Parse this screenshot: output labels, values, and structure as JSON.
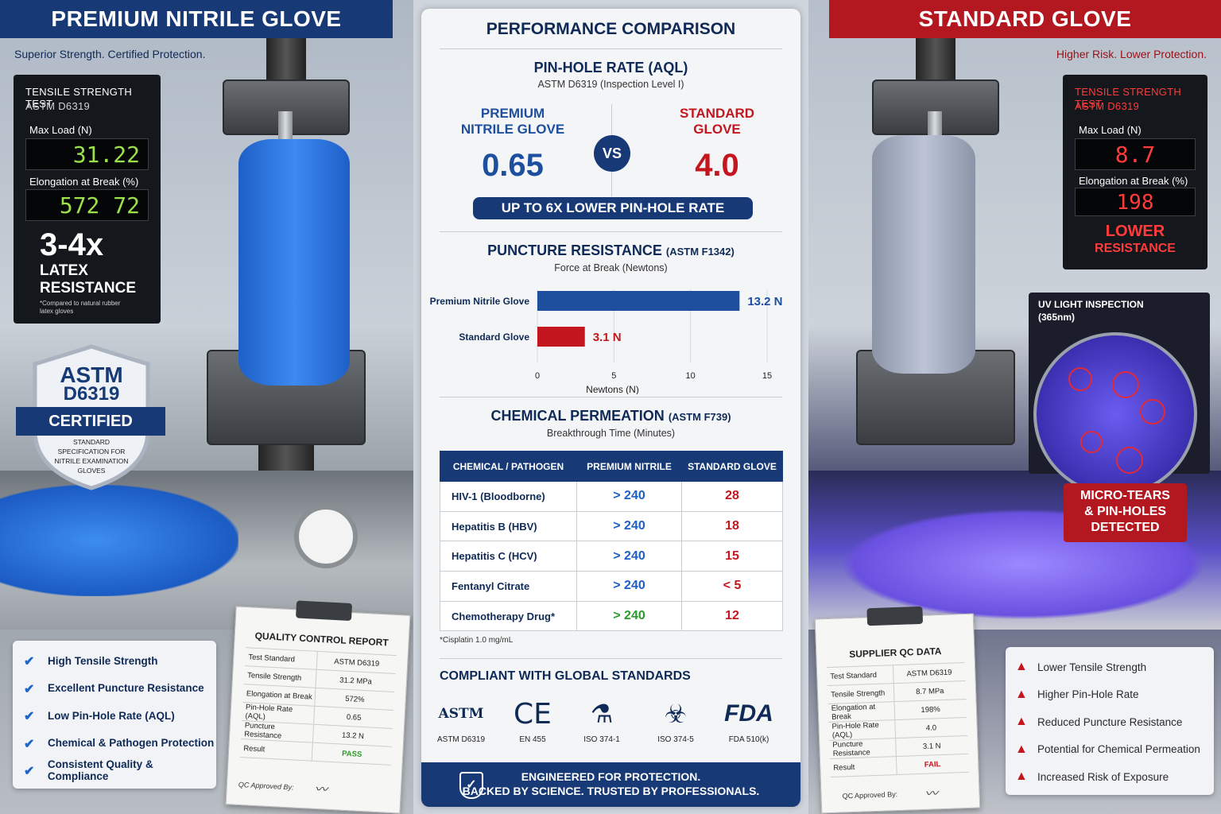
{
  "left": {
    "banner": "PREMIUM NITRILE GLOVE",
    "tagline": "Superior Strength. Certified Protection.",
    "test_panel": {
      "title": "TENSILE STRENGTH TEST",
      "standard": "ASTM D6319",
      "max_load_label": "Max Load (N)",
      "max_load_value": "31.22",
      "elongation_label": "Elongation at Break (%)",
      "elongation_value": "572 72",
      "headline": "3-4x",
      "sub1": "LATEX",
      "sub2": "RESISTANCE",
      "footnote": "*Compared to natural rubber latex gloves"
    },
    "badge": {
      "line1": "ASTM",
      "line2": "D6319",
      "ribbon": "CERTIFIED",
      "desc": "STANDARD SPECIFICATION FOR NITRILE EXAMINATION GLOVES"
    },
    "checklist": [
      "High Tensile Strength",
      "Excellent Puncture Resistance",
      "Low Pin-Hole Rate (AQL)",
      "Chemical & Pathogen Protection",
      "Consistent Quality & Compliance"
    ],
    "report": {
      "title": "QUALITY CONTROL REPORT",
      "rows": [
        {
          "k": "Test Standard",
          "v": "ASTM D6319"
        },
        {
          "k": "Tensile Strength",
          "v": "31.2 MPa"
        },
        {
          "k": "Elongation at Break",
          "v": "572%"
        },
        {
          "k": "Pin-Hole Rate (AQL)",
          "v": "0.65"
        },
        {
          "k": "Puncture Resistance",
          "v": "13.2 N"
        },
        {
          "k": "Result",
          "v": "PASS"
        }
      ],
      "approved": "QC Approved By:"
    }
  },
  "right": {
    "banner": "STANDARD GLOVE",
    "tagline": "Higher Risk. Lower Protection.",
    "test_panel": {
      "title": "TENSILE STRENGTH TEST",
      "standard": "ASTM D6319",
      "max_load_label": "Max Load (N)",
      "max_load_value": "8.7",
      "elongation_label": "Elongation at Break (%)",
      "elongation_value": "198",
      "line1": "LOWER",
      "line2": "RESISTANCE"
    },
    "uv": {
      "title": "UV LIGHT INSPECTION",
      "sub": "(365nm)"
    },
    "alert": {
      "l1": "MICRO-TEARS",
      "l2": "& PIN-HOLES",
      "l3": "DETECTED"
    },
    "warnings": [
      "Lower Tensile Strength",
      "Higher Pin-Hole Rate",
      "Reduced Puncture Resistance",
      "Potential for Chemical Permeation",
      "Increased Risk of Exposure"
    ],
    "report": {
      "title": "SUPPLIER QC DATA",
      "rows": [
        {
          "k": "Test Standard",
          "v": "ASTM D6319"
        },
        {
          "k": "Tensile Strength",
          "v": "8.7 MPa"
        },
        {
          "k": "Elongation at Break",
          "v": "198%"
        },
        {
          "k": "Pin-Hole Rate (AQL)",
          "v": "4.0"
        },
        {
          "k": "Puncture Resistance",
          "v": "3.1 N"
        },
        {
          "k": "Result",
          "v": "FAIL"
        }
      ],
      "approved": "QC Approved By:"
    }
  },
  "center": {
    "title": "PERFORMANCE COMPARISON",
    "pinhole": {
      "title": "PIN-HOLE RATE (AQL)",
      "sub": "ASTM D6319 (Inspection Level I)",
      "premium_l1": "PREMIUM",
      "premium_l2": "NITRILE GLOVE",
      "premium_value": "0.65",
      "vs": "VS",
      "standard_l1": "STANDARD",
      "standard_l2": "GLOVE",
      "standard_value": "4.0",
      "pill": "UP TO 6X LOWER PIN-HOLE RATE"
    },
    "puncture": {
      "title": "PUNCTURE RESISTANCE",
      "title_std": "(ASTM F1342)",
      "sub": "Force at Break (Newtons)"
    },
    "chemical": {
      "title": "CHEMICAL PERMEATION",
      "title_std": "(ASTM F739)",
      "sub": "Breakthrough Time (Minutes)",
      "headers": [
        "CHEMICAL / PATHOGEN",
        "PREMIUM NITRILE",
        "STANDARD GLOVE"
      ],
      "rows": [
        {
          "name": "HIV-1 (Bloodborne)",
          "premium": "> 240",
          "standard": "28"
        },
        {
          "name": "Hepatitis B (HBV)",
          "premium": "> 240",
          "standard": "18"
        },
        {
          "name": "Hepatitis C (HCV)",
          "premium": "> 240",
          "standard": "15"
        },
        {
          "name": "Fentanyl Citrate",
          "premium": "> 240",
          "standard": "< 5"
        },
        {
          "name": "Chemotherapy Drug*",
          "premium": "> 240",
          "standard": "12"
        }
      ],
      "footnote": "*Cisplatin 1.0 mg/mL"
    },
    "standards": {
      "title": "COMPLIANT WITH GLOBAL STANDARDS",
      "logos": [
        {
          "glyph": "ASTM",
          "label": "ASTM D6319"
        },
        {
          "glyph": "CE",
          "label": "EN 455"
        },
        {
          "glyph": "⚗",
          "label": "ISO 374-1"
        },
        {
          "glyph": "☣",
          "label": "ISO 374-5"
        },
        {
          "glyph": "FDA",
          "label": "FDA 510(k)"
        }
      ]
    },
    "footer": {
      "l1": "ENGINEERED FOR PROTECTION.",
      "l2": "BACKED BY SCIENCE. TRUSTED BY PROFESSIONALS."
    }
  },
  "chart_data": {
    "type": "bar",
    "orientation": "horizontal",
    "categories": [
      "Premium Nitrile Glove",
      "Standard Glove"
    ],
    "values": [
      13.2,
      3.1
    ],
    "value_labels": [
      "13.2 N",
      "3.1 N"
    ],
    "colors": [
      "#1d4f9e",
      "#c4161e"
    ],
    "xlabel": "Newtons (N)",
    "xlim": [
      0,
      15
    ],
    "xticks": [
      0,
      5,
      10,
      15
    ],
    "grid": true
  }
}
